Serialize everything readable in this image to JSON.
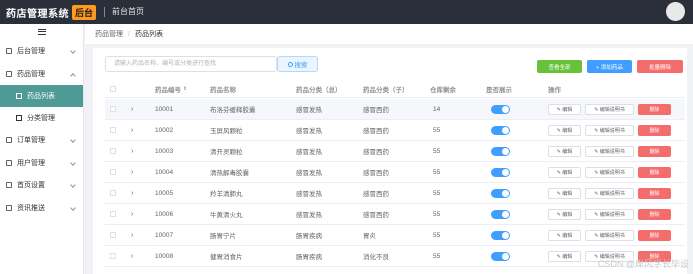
{
  "header": {
    "logo_text": "药店管理系统",
    "logo_badge": "后台",
    "home_link": "前台首页"
  },
  "sidebar": {
    "items": [
      {
        "label": "后台管理",
        "expanded": false
      },
      {
        "label": "药品管理",
        "expanded": true
      },
      {
        "label": "订单管理",
        "expanded": false
      },
      {
        "label": "用户管理",
        "expanded": false
      },
      {
        "label": "首页设置",
        "expanded": false
      },
      {
        "label": "资讯推送",
        "expanded": false
      }
    ],
    "sub_items": [
      {
        "label": "药品列表",
        "active": true
      },
      {
        "label": "分类管理",
        "active": false
      }
    ]
  },
  "breadcrumb": {
    "parent": "药品管理",
    "separator": "/",
    "current": "药品列表"
  },
  "toolbar": {
    "search_placeholder": "请输入药品名称、编号或分类进行查找",
    "search_label": "搜索",
    "btn_all": "查看全部",
    "btn_add": "+ 添加药品",
    "btn_batch_delete": "批量删除"
  },
  "table": {
    "headers": {
      "code": "药品编号",
      "sort_icon": "sort-icon",
      "name": "药品名称",
      "cat_main": "药品分类（总）",
      "cat_sub": "药品分类（子）",
      "stock": "仓库剩余",
      "show": "是否展示",
      "actions": "操作"
    },
    "row_actions": {
      "edit": "编辑",
      "manual": "编辑说明书",
      "delete": "删除"
    },
    "rows": [
      {
        "code": "10001",
        "name": "布洛芬缓释胶囊",
        "cat_main": "感冒发热",
        "cat_sub": "感冒西药",
        "stock": "14",
        "show": true
      },
      {
        "code": "10002",
        "name": "玉屏风颗粒",
        "cat_main": "感冒发热",
        "cat_sub": "感冒西药",
        "stock": "55",
        "show": true
      },
      {
        "code": "10003",
        "name": "清开灵颗粒",
        "cat_main": "感冒发热",
        "cat_sub": "感冒西药",
        "stock": "55",
        "show": true
      },
      {
        "code": "10004",
        "name": "清热解毒胶囊",
        "cat_main": "感冒发热",
        "cat_sub": "感冒西药",
        "stock": "55",
        "show": true
      },
      {
        "code": "10005",
        "name": "羚羊清肺丸",
        "cat_main": "感冒发热",
        "cat_sub": "感冒西药",
        "stock": "55",
        "show": true
      },
      {
        "code": "10006",
        "name": "牛黄清火丸",
        "cat_main": "感冒发热",
        "cat_sub": "感冒西药",
        "stock": "55",
        "show": true
      },
      {
        "code": "10007",
        "name": "肠胃宁片",
        "cat_main": "肠胃疾病",
        "cat_sub": "胃炎",
        "stock": "55",
        "show": true
      },
      {
        "code": "10008",
        "name": "健胃消食片",
        "cat_main": "肠胃疾病",
        "cat_sub": "消化不良",
        "stock": "55",
        "show": true
      }
    ]
  },
  "watermark": "CSDN @岸风学长毕设",
  "colors": {
    "topbar": "#2b2f3a",
    "accent_badge": "#ff9a1f",
    "active_menu": "#4e9a96",
    "primary": "#409eff",
    "success": "#67c23a",
    "danger": "#f56c6c"
  }
}
